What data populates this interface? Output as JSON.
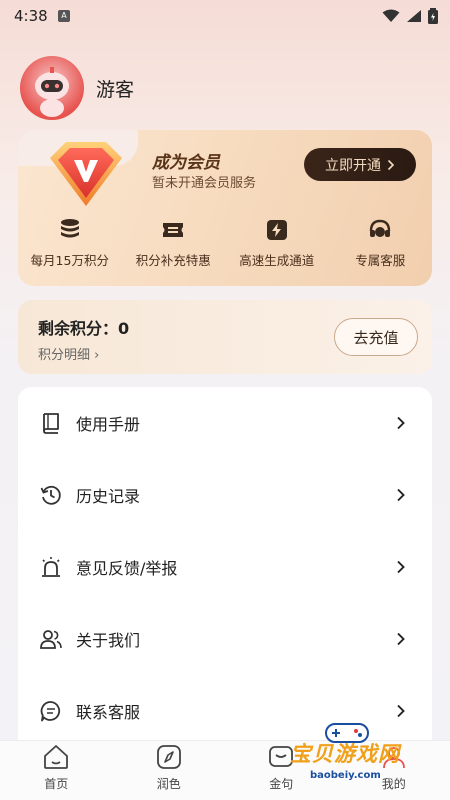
{
  "status": {
    "time": "4:38",
    "app_badge": "A"
  },
  "profile": {
    "username": "游客"
  },
  "vip": {
    "title": "成为会员",
    "subtitle": "暂未开通会员服务",
    "open_button": "立即开通",
    "benefits": [
      {
        "label": "每月15万积分",
        "icon": "coins-icon"
      },
      {
        "label": "积分补充特惠",
        "icon": "ticket-icon"
      },
      {
        "label": "高速生成通道",
        "icon": "lightning-icon"
      },
      {
        "label": "专属客服",
        "icon": "headset-icon"
      }
    ]
  },
  "points": {
    "title": "剩余积分：0",
    "detail_link": "积分明细 ›",
    "recharge_button": "去充值"
  },
  "menu": [
    {
      "label": "使用手册",
      "icon": "book-icon"
    },
    {
      "label": "历史记录",
      "icon": "history-icon"
    },
    {
      "label": "意见反馈/举报",
      "icon": "alarm-icon"
    },
    {
      "label": "关于我们",
      "icon": "people-icon"
    },
    {
      "label": "联系客服",
      "icon": "chat-icon"
    }
  ],
  "tabbar": [
    {
      "label": "首页",
      "icon": "home-icon"
    },
    {
      "label": "润色",
      "icon": "compass-icon"
    },
    {
      "label": "金句",
      "icon": "quote-icon"
    },
    {
      "label": "我的",
      "icon": "profile-icon"
    }
  ],
  "watermark": {
    "text": "宝贝游戏网",
    "url": "baobeiy.com"
  },
  "colors": {
    "accent_dark": "#2a1a12",
    "vip_text": "#5a3418",
    "brand_red": "#e7534f"
  }
}
